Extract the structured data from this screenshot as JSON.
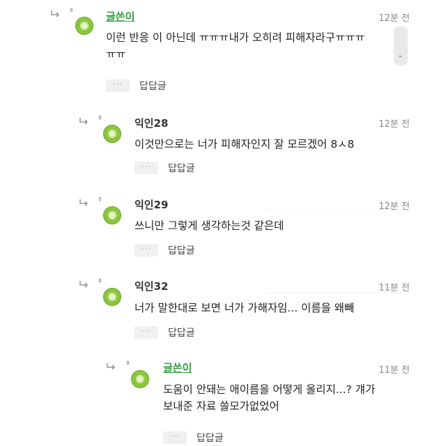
{
  "comments": [
    {
      "author": "글쓴이",
      "time": "12분 전",
      "text_lines": [
        "이런 반응 이 아닌데 ㅠㅠㅠ내가 오히려 피해자라구ㅠㅠㅠ",
        "ㅠㅠ"
      ],
      "reply_label": "답답글",
      "more_label": "···"
    },
    {
      "author": "익인28",
      "time": "12분 전",
      "text_lines": [
        "이것만으로는 너가 피해자인지 잘 모르겠어 8ㅅ8"
      ],
      "reply_label": "답답글",
      "more_label": "···"
    },
    {
      "author": "익인29",
      "time": "12분 전",
      "text_lines": [
        "쓰니만 그렇게 생각하는것 같은데"
      ],
      "reply_label": "답답글",
      "more_label": "···"
    },
    {
      "author": "익인32",
      "time": "11분 전",
      "text_lines": [
        "너가 말한대로 보면 너가 가해자임... 이름을 왜빼"
      ],
      "reply_label": "답답글",
      "more_label": "···"
    },
    {
      "author": "글쓴이",
      "time": "11분 전",
      "text_lines": [
        "도움이 안돼는 애이름을 어떻게 올리지...? 걔가",
        "보내준 자료 쓸모가없었어"
      ],
      "reply_label": "답답글",
      "more_label": "···"
    }
  ],
  "colors": {
    "op_author": "#2e9b3a",
    "avatar": "#8cc63f"
  },
  "icons": {
    "reply_arrow": "reply-arrow-icon",
    "scroll": "chevron-down-icon"
  }
}
